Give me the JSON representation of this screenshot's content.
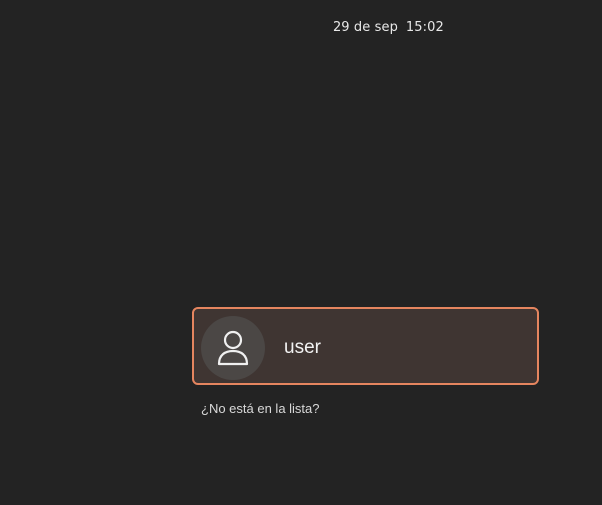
{
  "topbar": {
    "date": "29 de sep",
    "time": "15:02"
  },
  "login": {
    "users": [
      {
        "name": "user",
        "avatar_icon": "user-avatar-icon",
        "selected": true
      }
    ],
    "not_listed_label": "¿No está en la lista?"
  },
  "colors": {
    "background": "#232323",
    "accent_border": "#e5855f",
    "card_background": "#3f3532",
    "avatar_background": "#4b4745"
  }
}
